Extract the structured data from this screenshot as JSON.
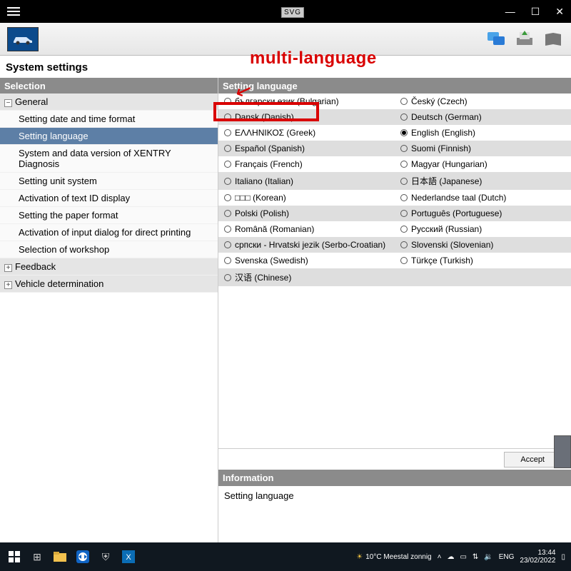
{
  "annotation": {
    "text": "multi-language"
  },
  "window": {
    "brand": "SVG"
  },
  "page": {
    "title": "System settings"
  },
  "left": {
    "header": "Selection",
    "groups": [
      {
        "label": "General",
        "expanded": true,
        "items": [
          "Setting date and time format",
          "Setting language",
          "System and data version of XENTRY Diagnosis",
          "Setting unit system",
          "Activation of text ID display",
          "Setting the paper format",
          "Activation of input dialog for direct printing",
          "Selection of workshop"
        ],
        "selectedIndex": 1
      },
      {
        "label": "Feedback",
        "expanded": false,
        "items": []
      },
      {
        "label": "Vehicle determination",
        "expanded": false,
        "items": []
      }
    ]
  },
  "right": {
    "header": "Setting language",
    "accept": "Accept",
    "info_header": "Information",
    "info_body": "Setting language",
    "languages": [
      [
        "български език (Bulgarian)",
        "Český (Czech)"
      ],
      [
        "Dansk (Danish)",
        "Deutsch (German)"
      ],
      [
        "ΕΛΛΗΝΙΚΟΣ (Greek)",
        "English (English)"
      ],
      [
        "Español (Spanish)",
        "Suomi (Finnish)"
      ],
      [
        "Français (French)",
        "Magyar (Hungarian)"
      ],
      [
        "Italiano (Italian)",
        "日本語 (Japanese)"
      ],
      [
        "□□□ (Korean)",
        "Nederlandse taal (Dutch)"
      ],
      [
        "Polski (Polish)",
        "Português (Portuguese)"
      ],
      [
        "Română (Romanian)",
        "Русский (Russian)"
      ],
      [
        "српски - Hrvatski jezik (Serbo-Croatian)",
        "Slovenski (Slovenian)"
      ],
      [
        "Svenska (Swedish)",
        "Türkçe (Turkish)"
      ],
      [
        "汉语 (Chinese)",
        ""
      ]
    ],
    "selected": "English (English)"
  },
  "taskbar": {
    "weather": "10°C  Meestal zonnig",
    "lang": "ENG",
    "time": "13:44",
    "date": "23/02/2022"
  }
}
